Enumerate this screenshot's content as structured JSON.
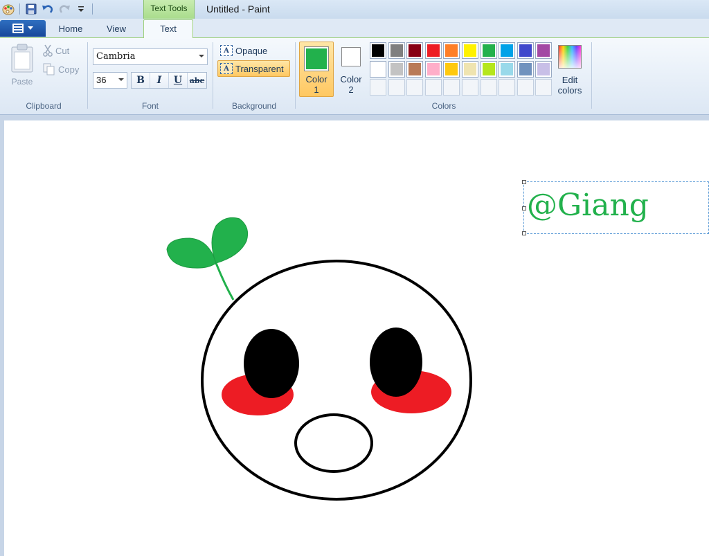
{
  "window": {
    "title": "Untitled - Paint",
    "context_tab": "Text Tools"
  },
  "tabs": {
    "home": "Home",
    "view": "View",
    "text": "Text"
  },
  "ribbon": {
    "clipboard": {
      "label": "Clipboard",
      "paste": "Paste",
      "cut": "Cut",
      "copy": "Copy"
    },
    "font": {
      "label": "Font",
      "name": "Cambria",
      "size": "36",
      "bold": "B",
      "italic": "I",
      "underline": "U",
      "strike": "abc"
    },
    "background": {
      "label": "Background",
      "opaque": "Opaque",
      "transparent": "Transparent",
      "icon_glyph": "A"
    },
    "colors": {
      "label": "Colors",
      "color1_label_line1": "Color",
      "color1_label_line2": "1",
      "color2_label_line1": "Color",
      "color2_label_line2": "2",
      "color1": "#22b14c",
      "color2": "#ffffff",
      "edit_label_line1": "Edit",
      "edit_label_line2": "colors",
      "palette": [
        "#000000",
        "#7f7f7f",
        "#880015",
        "#ed1c24",
        "#ff7f27",
        "#fff200",
        "#22b14c",
        "#00a2e8",
        "#3f48cc",
        "#a349a4",
        "#ffffff",
        "#c3c3c3",
        "#b97a57",
        "#ffaec9",
        "#ffc90e",
        "#efe4b0",
        "#b5e61d",
        "#99d9ea",
        "#7092be",
        "#c8bfe7",
        "",
        "",
        "",
        "",
        "",
        "",
        "",
        "",
        "",
        ""
      ]
    }
  },
  "canvas": {
    "text": "@Giang",
    "text_color": "#22b14c"
  },
  "icons": {
    "app": "paint-app-icon",
    "save": "save-icon",
    "undo": "undo-icon",
    "redo": "redo-icon",
    "customize": "customize-qat-icon",
    "menu": "app-menu-icon",
    "paste": "clipboard-icon",
    "cut": "scissors-icon",
    "copy": "copy-icon"
  }
}
